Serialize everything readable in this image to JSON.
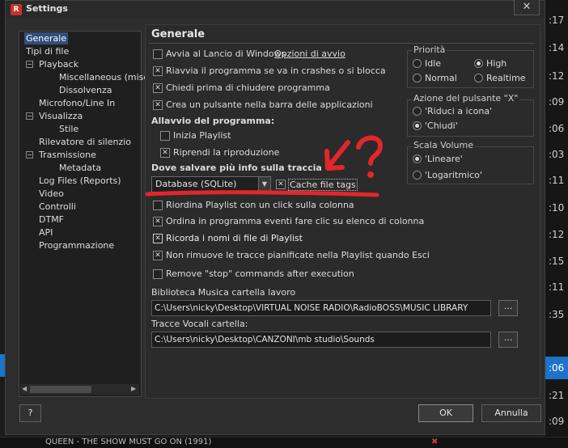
{
  "window": {
    "title": "Settings",
    "close_label": "✕"
  },
  "tree": {
    "items": [
      {
        "label": "Generale",
        "selected": true
      },
      {
        "label": "Tipi di file"
      },
      {
        "label": "Playback",
        "expander": "−"
      },
      {
        "label": "Miscellaneous (miscela"
      },
      {
        "label": "Dissolvenza"
      },
      {
        "label": "Microfono/Line In"
      },
      {
        "label": "Visualizza",
        "expander": "−"
      },
      {
        "label": "Stile"
      },
      {
        "label": "Rilevatore di silenzio"
      },
      {
        "label": "Trasmissione",
        "expander": "−"
      },
      {
        "label": "Metadata"
      },
      {
        "label": "Log Files (Reports)"
      },
      {
        "label": "Video"
      },
      {
        "label": "Controlli"
      },
      {
        "label": "DTMF"
      },
      {
        "label": "API"
      },
      {
        "label": "Programmazione"
      }
    ]
  },
  "main": {
    "title": "Generale",
    "checkboxes": [
      {
        "label": "Avvia al Lancio di Windows",
        "checked": false
      },
      {
        "label": "Riavvia il programma se va in crashes o si blocca",
        "checked": true
      },
      {
        "label": "Chiedi prima di chiudere programma",
        "checked": true
      },
      {
        "label": "Crea un pulsante nella barra delle applicazioni",
        "checked": true
      }
    ],
    "startup_options_link": "Opzioni di avvio",
    "startup_heading": "Allavvio del programma:",
    "startup_checkboxes": [
      {
        "label": "Inizia Playlist",
        "checked": false
      },
      {
        "label": "Riprendi la riproduzione",
        "checked": true
      }
    ],
    "storage_heading": "Dove salvare più info sulla traccia",
    "storage_select": "Database (SQLite)",
    "cache_label": "Cache file tags",
    "cache_checked": true,
    "more_checkboxes": [
      {
        "label": "Riordina Playlist con un click sulla colonna",
        "checked": false
      },
      {
        "label": "Ordina in programma eventi fare clic su elenco di colonna",
        "checked": true
      },
      {
        "label": "Ricorda i nomi di file di Playlist",
        "checked": true
      },
      {
        "label": "Non rimuove le tracce pianificate nella Playlist quando Esci",
        "checked": true
      },
      {
        "label": "Remove \"stop\" commands after execution",
        "checked": false
      }
    ],
    "music_folder_label": "Biblioteca Musica cartella lavoro",
    "music_folder_value": "C:\\Users\\nicky\\Desktop\\VIRTUAL NOISE RADIO\\RadioBOSS\\MUSIC LIBRARY",
    "voice_folder_label": "Tracce Vocali cartella:",
    "voice_folder_value": "C:\\Users\\nicky\\Desktop\\CANZONI\\mb studio\\Sounds",
    "browse_label": "...",
    "priority": {
      "label": "Priorità",
      "options": [
        {
          "label": "Idle",
          "selected": false
        },
        {
          "label": "High",
          "selected": true
        },
        {
          "label": "Normal",
          "selected": false
        },
        {
          "label": "Realtime",
          "selected": false
        }
      ]
    },
    "x_action": {
      "label": "Azione del pulsante \"X\"",
      "options": [
        {
          "label": "'Riduci a icona'",
          "selected": false
        },
        {
          "label": "'Chiudi'",
          "selected": true
        }
      ]
    },
    "volume_scale": {
      "label": "Scala Volume",
      "options": [
        {
          "label": "'Lineare'",
          "selected": true
        },
        {
          "label": "'Logaritmico'",
          "selected": false
        }
      ]
    }
  },
  "buttons": {
    "help": "?",
    "ok": "OK",
    "cancel": "Annulla"
  },
  "background": {
    "times": [
      ":17",
      ":14",
      ":12",
      ":09",
      ":06",
      ":03",
      ":11",
      ":10",
      ":12",
      ":15",
      ":11",
      ":35",
      ":06",
      ":21",
      ":09"
    ],
    "highlight_time": ":06",
    "bottom_text": "QUEEN - THE SHOW MUST GO ON (1991)",
    "accent_color": "#1d73c9",
    "annotation_color": "#e3262b"
  }
}
